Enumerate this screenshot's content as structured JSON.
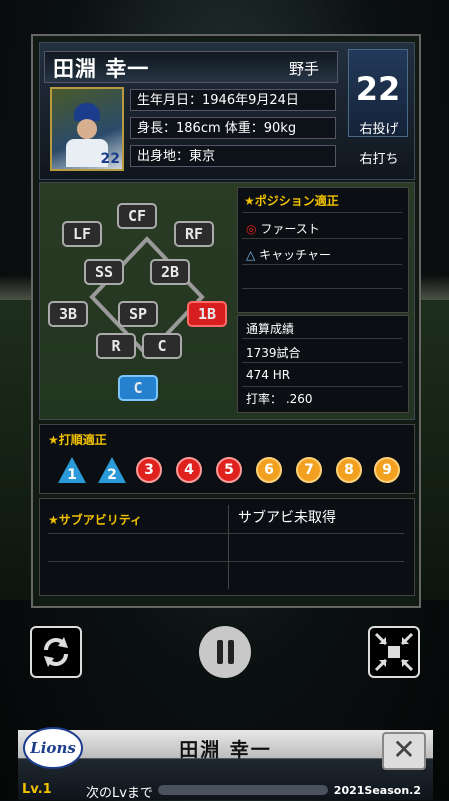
{
  "player": {
    "name": "田淵 幸一",
    "position": "野手",
    "number": "22",
    "photo_number": "22",
    "birth": "生年月日：1946年9月24日",
    "body": "身長：186cm 体重：90kg",
    "hometown": "出身地：東京",
    "throws": "右投げ",
    "bats": "右打ち"
  },
  "field_positions": [
    {
      "label": "CF",
      "state": "normal"
    },
    {
      "label": "LF",
      "state": "normal"
    },
    {
      "label": "RF",
      "state": "normal"
    },
    {
      "label": "SS",
      "state": "normal"
    },
    {
      "label": "2B",
      "state": "normal"
    },
    {
      "label": "3B",
      "state": "normal"
    },
    {
      "label": "SP",
      "state": "normal"
    },
    {
      "label": "1B",
      "state": "red"
    },
    {
      "label": "R",
      "state": "normal"
    },
    {
      "label": "C",
      "state": "normal"
    },
    {
      "label": "C",
      "state": "blue"
    }
  ],
  "position_aptitude": {
    "title": "★ポジション適正",
    "items": [
      {
        "mark": "◎",
        "name": "ファースト"
      },
      {
        "mark": "△",
        "name": "キャッチャー"
      }
    ]
  },
  "career_stats": {
    "title": "通算成績",
    "games": "1739試合",
    "hr": "474 HR",
    "avg": "打率： .260"
  },
  "batting_order": {
    "title": "★打順適正",
    "slots": [
      {
        "n": "1",
        "grade": "triangle"
      },
      {
        "n": "2",
        "grade": "triangle"
      },
      {
        "n": "3",
        "grade": "red"
      },
      {
        "n": "4",
        "grade": "red"
      },
      {
        "n": "5",
        "grade": "red"
      },
      {
        "n": "6",
        "grade": "orange"
      },
      {
        "n": "7",
        "grade": "orange"
      },
      {
        "n": "8",
        "grade": "orange"
      },
      {
        "n": "9",
        "grade": "orange"
      }
    ]
  },
  "sub_ability": {
    "title": "★サブアビリティ",
    "status": "サブアビ未取得"
  },
  "controls": [
    "refresh-icon",
    "pause-icon",
    "collapse-icon"
  ],
  "bottom": {
    "team_logo": "Lions",
    "name": "田淵 幸一",
    "close": "✕",
    "level": "Lv.1",
    "next_level": "次のLvまで",
    "season": "2021Season.2"
  },
  "colors": {
    "accent": "#f2c200",
    "red": "#d81f1f",
    "blue": "#2680d0",
    "orange": "#f2a020"
  }
}
